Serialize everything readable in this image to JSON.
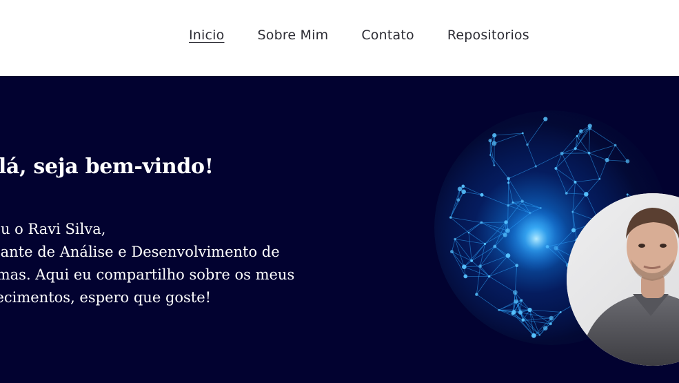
{
  "nav": {
    "items": [
      {
        "label": "Inicio",
        "active": true
      },
      {
        "label": "Sobre Mim",
        "active": false
      },
      {
        "label": "Contato",
        "active": false
      },
      {
        "label": "Repositorios",
        "active": false
      }
    ]
  },
  "hero": {
    "title": "Olá, seja bem-vindo!",
    "lines": [
      "Eu sou o Ravi Silva,",
      "estudante de Análise e Desenvolvimento de",
      "Sistemas. Aqui eu compartilho sobre os meus",
      "conhecimentos, espero que goste!"
    ]
  },
  "colors": {
    "hero_background": "#020230",
    "nav_background": "#ffffff",
    "nav_text": "#2c2c34",
    "hero_text": "#ffffff",
    "network_accent": "#2fa8ff"
  }
}
